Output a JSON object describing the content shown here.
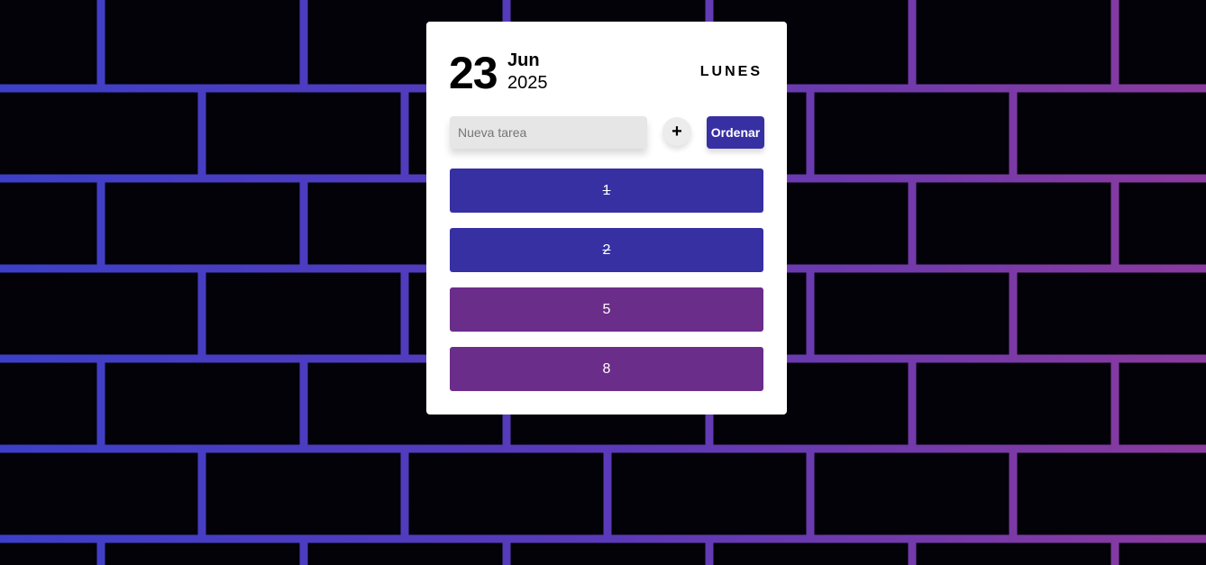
{
  "date": {
    "day": "23",
    "month": "Jun",
    "year": "2025",
    "weekday": "LUNES"
  },
  "form": {
    "input_placeholder": "Nueva tarea",
    "input_value": "",
    "add_label": "+",
    "sort_label": "Ordenar"
  },
  "tasks": [
    {
      "label": "1",
      "done": true,
      "color": "#3730a3"
    },
    {
      "label": "2",
      "done": true,
      "color": "#3730a3"
    },
    {
      "label": "5",
      "done": false,
      "color": "#6b2d8a"
    },
    {
      "label": "8",
      "done": false,
      "color": "#6b2d8a"
    }
  ],
  "colors": {
    "accent": "#3730a3",
    "pending": "#6b2d8a",
    "background_brick_left": "#3d3fc8",
    "background_brick_right": "#8a3a9e"
  }
}
